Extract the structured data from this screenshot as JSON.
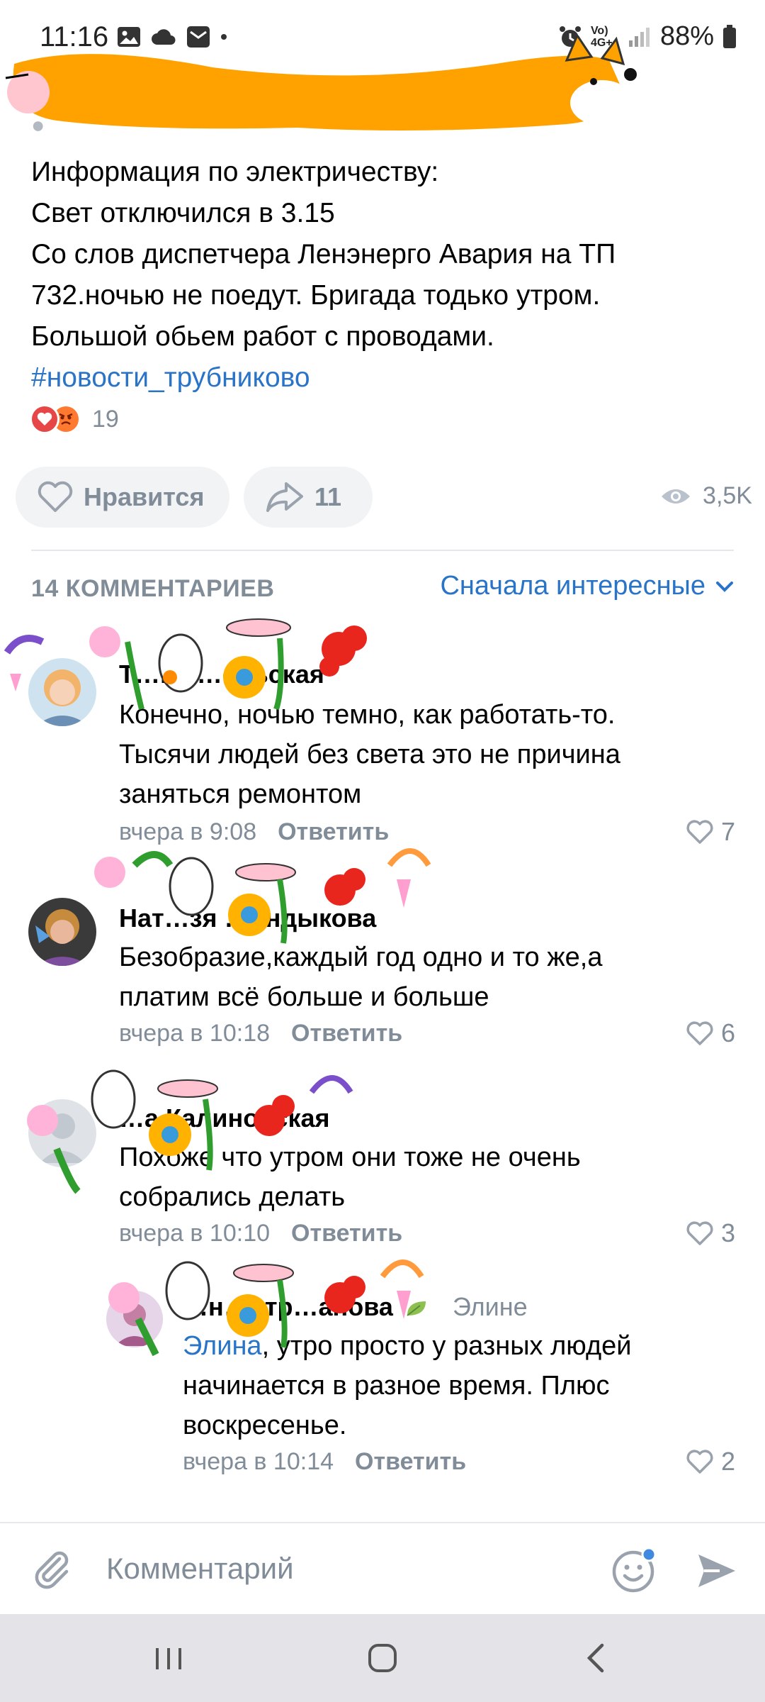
{
  "status_bar": {
    "time": "11:16",
    "battery": "88%",
    "network_label": "Vo) 4G+",
    "icons": [
      "gallery-icon",
      "cloud-icon",
      "mail-icon",
      "dot-icon",
      "alarm-icon",
      "signal-icon",
      "battery-icon"
    ]
  },
  "post": {
    "lines": [
      "Информация по электричеству:",
      "Свет отключился в 3.15",
      "Со слов диспетчера Ленэнерго Авария на ТП",
      "732.ночью не поедут. Бригада тодько утром.",
      "Большой обьем работ с проводами."
    ],
    "hashtag": "#новости_трубниково",
    "reactions_count": "19",
    "like_label": "Нравится",
    "share_count": "11",
    "views": "3,5K"
  },
  "comments_header": {
    "count_label": "14 КОММЕНТАРИЕВ",
    "sort_label": "Сначала интересные"
  },
  "comments": [
    {
      "author": "Т…на …ельская",
      "lines": [
        "Конечно, ночью темно, как работать-то.",
        "Тысячи людей без света это не причина",
        "заняться ремонтом"
      ],
      "time": "вчера в 9:08",
      "reply": "Ответить",
      "likes": "7"
    },
    {
      "author": "Нат…зя …индыкова",
      "lines": [
        "Безобразие,каждый год одно и то же,а",
        "платим всё больше и больше"
      ],
      "time": "вчера в 10:18",
      "reply": "Ответить",
      "likes": "6"
    },
    {
      "author": "…а Калиновская",
      "lines": [
        "Похоже что утром они тоже не очень",
        "собрались делать"
      ],
      "time": "вчера в 10:10",
      "reply": "Ответить",
      "likes": "3"
    },
    {
      "author": "…н…итр…анова",
      "reply_to": "Элине",
      "mention": "Элина",
      "lines": [
        ", утро просто у разных людей",
        "начинается в разное время. Плюс",
        "воскресенье."
      ],
      "time": "вчера в 10:14",
      "reply": "Ответить",
      "likes": "2"
    }
  ],
  "composer": {
    "placeholder": "Комментарий"
  },
  "colors": {
    "accent": "#2a74c8",
    "secondary_text": "#818c99",
    "pill_bg": "#f2f3f5",
    "sticker_orange": "#ffa200"
  }
}
